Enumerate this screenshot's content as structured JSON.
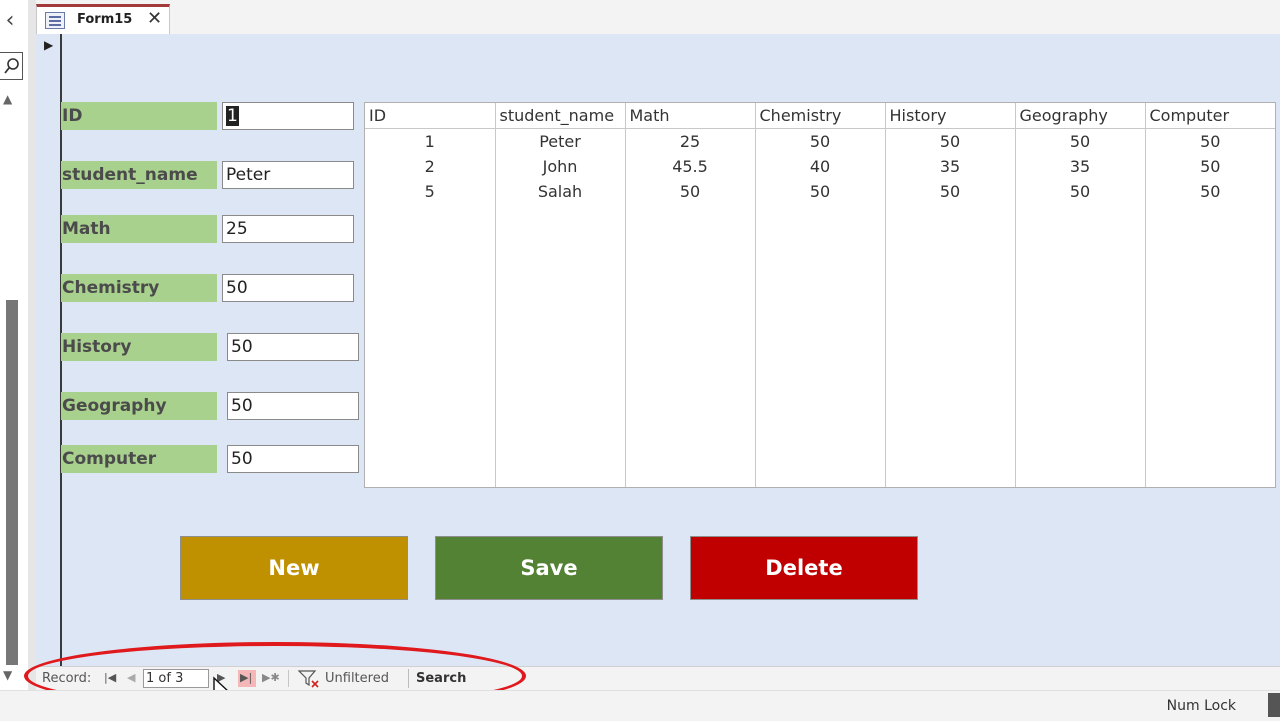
{
  "tab": {
    "title": "Form15"
  },
  "form": {
    "fields": [
      {
        "label": "ID",
        "value": "1"
      },
      {
        "label": "student_name",
        "value": "Peter"
      },
      {
        "label": "Math",
        "value": "25"
      },
      {
        "label": "Chemistry",
        "value": "50"
      },
      {
        "label": "History",
        "value": "50"
      },
      {
        "label": "Geography",
        "value": "50"
      },
      {
        "label": "Computer",
        "value": "50"
      }
    ]
  },
  "datasheet": {
    "columns": [
      "ID",
      "student_name",
      "Math",
      "Chemistry",
      "History",
      "Geography",
      "Computer"
    ],
    "rows": [
      [
        "1",
        "Peter",
        "25",
        "50",
        "50",
        "50",
        "50"
      ],
      [
        "2",
        "John",
        "45.5",
        "40",
        "35",
        "35",
        "50"
      ],
      [
        "5",
        "Salah",
        "50",
        "50",
        "50",
        "50",
        "50"
      ]
    ]
  },
  "buttons": {
    "new": {
      "label": "New",
      "color": "#bf9000"
    },
    "save": {
      "label": "Save",
      "color": "#548235"
    },
    "delete": {
      "label": "Delete",
      "color": "#c00000"
    }
  },
  "navigation": {
    "record_label": "Record:",
    "record_position": "1 of 3",
    "filter_status": "Unfiltered",
    "search_label": "Search"
  },
  "statusbar": {
    "numlock": "Num Lock"
  },
  "colors": {
    "form_background": "#dce6f4",
    "label_background": "#a9d18e",
    "annotation": "#e0191c"
  }
}
